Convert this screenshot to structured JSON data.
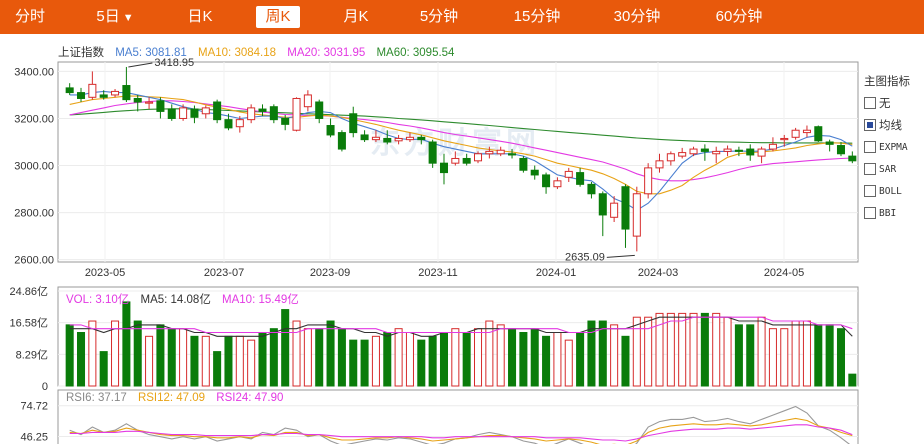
{
  "tabs": [
    {
      "label": "分时",
      "active": false
    },
    {
      "label": "5日",
      "active": false,
      "dropdown": true
    },
    {
      "label": "日K",
      "active": false
    },
    {
      "label": "周K",
      "active": true
    },
    {
      "label": "月K",
      "active": false
    },
    {
      "label": "5分钟",
      "active": false
    },
    {
      "label": "15分钟",
      "active": false
    },
    {
      "label": "30分钟",
      "active": false
    },
    {
      "label": "60分钟",
      "active": false
    }
  ],
  "dropdown_icon": "caret-down-icon",
  "indicator_panel": {
    "title": "主图指标",
    "items": [
      {
        "label": "无",
        "checked": false
      },
      {
        "label": "均线",
        "checked": true
      },
      {
        "label": "EXPMA",
        "checked": false
      },
      {
        "label": "SAR",
        "checked": false
      },
      {
        "label": "BOLL",
        "checked": false
      },
      {
        "label": "BBI",
        "checked": false
      }
    ]
  },
  "price_legend": {
    "name": "上证指数",
    "ma5": "MA5: 3081.81",
    "ma10": "MA10: 3084.18",
    "ma20": "MA20: 3031.95",
    "ma60": "MA60: 3095.54"
  },
  "volume_legend": {
    "vol": "VOL: 3.10亿",
    "ma5": "MA5: 14.08亿",
    "ma10": "MA10: 15.49亿"
  },
  "rsi_legend": {
    "rsi6": "RSI6: 37.17",
    "rsi12": "RSI12: 47.09",
    "rsi24": "RSI24: 47.90"
  },
  "watermark": "东方财富网",
  "colors": {
    "up": "#d62b2b",
    "down": "#0a7c0a",
    "ma5": "#4a7fd0",
    "ma10": "#e8a317",
    "ma20": "#e339e3",
    "ma60": "#2e8b2e",
    "accent": "#e8590c"
  },
  "chart_data": [
    {
      "type": "candlestick",
      "title": "上证指数",
      "y_ticks": [
        "3400.00",
        "3200.00",
        "3000.00",
        "2800.00",
        "2600.00"
      ],
      "ylim": [
        2590,
        3440
      ],
      "x_ticks": [
        "2023-05",
        "2023-07",
        "2023-09",
        "2023-11",
        "2024-01",
        "2024-03",
        "2024-05"
      ],
      "annotations": {
        "high": "3418.95",
        "low": "2635.09"
      },
      "candles": [
        [
          3330,
          3310,
          3350,
          3300
        ],
        [
          3310,
          3285,
          3330,
          3270
        ],
        [
          3290,
          3345,
          3400,
          3280
        ],
        [
          3300,
          3290,
          3320,
          3280
        ],
        [
          3300,
          3315,
          3325,
          3290
        ],
        [
          3340,
          3280,
          3418.95,
          3270
        ],
        [
          3285,
          3270,
          3300,
          3230
        ],
        [
          3265,
          3270,
          3290,
          3240
        ],
        [
          3275,
          3230,
          3290,
          3200
        ],
        [
          3240,
          3200,
          3260,
          3190
        ],
        [
          3200,
          3245,
          3260,
          3190
        ],
        [
          3240,
          3205,
          3255,
          3180
        ],
        [
          3220,
          3245,
          3255,
          3200
        ],
        [
          3270,
          3195,
          3280,
          3180
        ],
        [
          3195,
          3160,
          3220,
          3150
        ],
        [
          3165,
          3195,
          3210,
          3140
        ],
        [
          3195,
          3245,
          3260,
          3180
        ],
        [
          3240,
          3230,
          3260,
          3210
        ],
        [
          3250,
          3195,
          3260,
          3180
        ],
        [
          3200,
          3175,
          3215,
          3150
        ],
        [
          3150,
          3285,
          3290,
          3145
        ],
        [
          3250,
          3300,
          3320,
          3230
        ],
        [
          3270,
          3200,
          3280,
          3180
        ],
        [
          3170,
          3130,
          3200,
          3120
        ],
        [
          3140,
          3070,
          3150,
          3060
        ],
        [
          3220,
          3140,
          3250,
          3120
        ],
        [
          3130,
          3110,
          3150,
          3100
        ],
        [
          3110,
          3120,
          3150,
          3100
        ],
        [
          3115,
          3100,
          3150,
          3090
        ],
        [
          3105,
          3115,
          3130,
          3090
        ],
        [
          3110,
          3120,
          3140,
          3100
        ],
        [
          3120,
          3110,
          3130,
          3090
        ],
        [
          3100,
          3010,
          3110,
          2990
        ],
        [
          3010,
          2970,
          3050,
          2920
        ],
        [
          3010,
          3030,
          3060,
          3000
        ],
        [
          3030,
          3010,
          3050,
          3000
        ],
        [
          3020,
          3050,
          3060,
          3010
        ],
        [
          3050,
          3060,
          3080,
          3030
        ],
        [
          3050,
          3065,
          3080,
          3040
        ],
        [
          3050,
          3045,
          3070,
          3030
        ],
        [
          3030,
          2980,
          3040,
          2970
        ],
        [
          2980,
          2960,
          3000,
          2940
        ],
        [
          2960,
          2910,
          2970,
          2880
        ],
        [
          2910,
          2935,
          2950,
          2900
        ],
        [
          2950,
          2975,
          2990,
          2930
        ],
        [
          2970,
          2920,
          2990,
          2910
        ],
        [
          2920,
          2880,
          2930,
          2860
        ],
        [
          2880,
          2790,
          2890,
          2700
        ],
        [
          2780,
          2840,
          2870,
          2760
        ],
        [
          2910,
          2730,
          2920,
          2650
        ],
        [
          2700,
          2880,
          2910,
          2635.09
        ],
        [
          2880,
          2990,
          3010,
          2860
        ],
        [
          2990,
          3020,
          3050,
          2970
        ],
        [
          3020,
          3050,
          3060,
          3000
        ],
        [
          3040,
          3055,
          3075,
          3030
        ],
        [
          3050,
          3070,
          3080,
          3040
        ],
        [
          3070,
          3060,
          3090,
          3020
        ],
        [
          3050,
          3060,
          3080,
          3010
        ],
        [
          3060,
          3070,
          3085,
          3040
        ],
        [
          3065,
          3060,
          3080,
          3040
        ],
        [
          3070,
          3045,
          3090,
          3020
        ],
        [
          3040,
          3070,
          3080,
          3010
        ],
        [
          3070,
          3090,
          3120,
          3060
        ],
        [
          3110,
          3115,
          3130,
          3080
        ],
        [
          3120,
          3150,
          3160,
          3110
        ],
        [
          3140,
          3150,
          3170,
          3120
        ],
        [
          3165,
          3105,
          3170,
          3100
        ],
        [
          3100,
          3090,
          3110,
          3060
        ],
        [
          3085,
          3050,
          3100,
          3040
        ],
        [
          3040,
          3020,
          3060,
          3010
        ]
      ],
      "ma5": [
        3300,
        3300,
        3310,
        3315,
        3310,
        3310,
        3300,
        3290,
        3280,
        3265,
        3250,
        3240,
        3225,
        3220,
        3210,
        3200,
        3205,
        3210,
        3210,
        3200,
        3210,
        3225,
        3230,
        3225,
        3200,
        3180,
        3165,
        3150,
        3130,
        3115,
        3110,
        3112,
        3095,
        3080,
        3070,
        3060,
        3050,
        3050,
        3050,
        3050,
        3040,
        3020,
        2990,
        2960,
        2950,
        2940,
        2935,
        2900,
        2860,
        2840,
        2810,
        2840,
        2890,
        2950,
        3010,
        3045,
        3055,
        3060,
        3060,
        3062,
        3060,
        3062,
        3070,
        3085,
        3100,
        3120,
        3128,
        3125,
        3110,
        3082
      ],
      "ma10": [
        3260,
        3270,
        3280,
        3285,
        3290,
        3295,
        3295,
        3292,
        3290,
        3285,
        3280,
        3270,
        3258,
        3248,
        3238,
        3228,
        3220,
        3215,
        3210,
        3205,
        3205,
        3210,
        3215,
        3210,
        3205,
        3195,
        3185,
        3175,
        3162,
        3150,
        3140,
        3130,
        3118,
        3105,
        3095,
        3085,
        3075,
        3068,
        3062,
        3058,
        3050,
        3040,
        3025,
        3010,
        3000,
        2990,
        2980,
        2965,
        2945,
        2920,
        2890,
        2880,
        2880,
        2895,
        2915,
        2950,
        2980,
        3005,
        3035,
        3050,
        3055,
        3058,
        3062,
        3068,
        3075,
        3085,
        3092,
        3097,
        3095,
        3090
      ],
      "ma20": [
        3215,
        3225,
        3235,
        3245,
        3255,
        3262,
        3268,
        3272,
        3275,
        3275,
        3272,
        3268,
        3262,
        3256,
        3250,
        3242,
        3235,
        3228,
        3222,
        3217,
        3215,
        3213,
        3212,
        3210,
        3205,
        3200,
        3195,
        3190,
        3183,
        3175,
        3168,
        3160,
        3150,
        3140,
        3132,
        3125,
        3118,
        3110,
        3103,
        3095,
        3085,
        3075,
        3065,
        3055,
        3045,
        3035,
        3025,
        3015,
        3000,
        2985,
        2965,
        2950,
        2940,
        2935,
        2935,
        2940,
        2948,
        2958,
        2970,
        2983,
        2994,
        3002,
        3008,
        3012,
        3016,
        3020,
        3024,
        3027,
        3030,
        3032
      ],
      "ma60": [
        3215,
        3218,
        3222,
        3226,
        3230,
        3233,
        3236,
        3239,
        3240,
        3241,
        3241,
        3240,
        3238,
        3236,
        3234,
        3232,
        3230,
        3228,
        3226,
        3224,
        3222,
        3220,
        3218,
        3216,
        3214,
        3212,
        3210,
        3207,
        3204,
        3200,
        3197,
        3194,
        3190,
        3186,
        3182,
        3178,
        3174,
        3170,
        3166,
        3161,
        3157,
        3153,
        3149,
        3145,
        3141,
        3137,
        3133,
        3129,
        3125,
        3121,
        3117,
        3114,
        3111,
        3108,
        3106,
        3104,
        3102,
        3101,
        3100,
        3099,
        3098,
        3097,
        3097,
        3096,
        3096,
        3096,
        3096,
        3096,
        3096,
        3095
      ]
    },
    {
      "type": "bar",
      "title": "VOL",
      "unit": "亿",
      "y_ticks": [
        "24.86亿",
        "16.58亿",
        "8.29亿",
        "0"
      ],
      "ylim": [
        0,
        24.86
      ],
      "values": [
        16,
        14,
        17,
        9,
        17,
        22,
        17,
        13,
        16,
        15,
        15,
        13,
        13,
        9,
        13,
        13,
        12,
        14,
        15,
        20,
        17,
        15,
        15,
        17,
        15,
        12,
        12,
        13,
        14,
        15,
        14,
        12,
        13,
        14,
        15,
        14,
        15,
        17,
        16,
        15,
        14,
        15,
        13,
        14,
        12,
        14,
        17,
        17,
        16,
        13,
        18,
        18,
        19,
        19,
        19,
        19,
        19,
        19,
        18,
        16,
        16,
        18,
        15,
        15,
        17,
        17,
        16,
        16,
        15,
        3.1
      ],
      "ma5": [
        15,
        15,
        15,
        14,
        15,
        15,
        16,
        16,
        16,
        15,
        15,
        14,
        14,
        13,
        13,
        13,
        13,
        13,
        14,
        15,
        15,
        16,
        16,
        16,
        15,
        15,
        14,
        14,
        13,
        14,
        14,
        13,
        13,
        14,
        14,
        14,
        15,
        15,
        15,
        15,
        15,
        15,
        14,
        14,
        14,
        14,
        15,
        15,
        15,
        15,
        16,
        17,
        18,
        18,
        18,
        18,
        18,
        18,
        18,
        17,
        17,
        17,
        16,
        16,
        16,
        16,
        16,
        16,
        16,
        13
      ],
      "ma10": [
        16,
        16,
        15,
        15,
        15,
        15,
        15,
        15,
        15,
        15,
        15,
        15,
        14,
        14,
        14,
        14,
        14,
        14,
        14,
        14,
        14,
        15,
        15,
        15,
        15,
        15,
        15,
        15,
        14,
        14,
        14,
        14,
        14,
        14,
        14,
        14,
        14,
        14,
        15,
        15,
        15,
        15,
        15,
        15,
        14,
        14,
        14,
        15,
        15,
        15,
        15,
        15,
        16,
        17,
        17,
        18,
        18,
        18,
        18,
        18,
        18,
        18,
        17,
        17,
        17,
        17,
        16,
        16,
        16,
        15
      ]
    },
    {
      "type": "line",
      "title": "RSI",
      "y_ticks": [
        "74.72",
        "46.25"
      ],
      "ylim": [
        30,
        80
      ],
      "series": [
        {
          "name": "RSI6",
          "values": [
            52,
            48,
            55,
            50,
            52,
            58,
            52,
            48,
            46,
            44,
            46,
            44,
            46,
            42,
            44,
            46,
            44,
            50,
            48,
            54,
            52,
            46,
            48,
            42,
            38,
            40,
            42,
            44,
            43,
            45,
            44,
            41,
            38,
            40,
            44,
            45,
            48,
            50,
            48,
            46,
            42,
            40,
            36,
            40,
            44,
            40,
            36,
            30,
            34,
            31,
            40,
            55,
            60,
            62,
            62,
            64,
            60,
            61,
            63,
            60,
            58,
            62,
            66,
            70,
            74,
            68,
            56,
            52,
            45,
            37
          ]
        },
        {
          "name": "RSI12",
          "values": [
            50,
            49,
            52,
            50,
            51,
            54,
            52,
            50,
            48,
            47,
            47,
            46,
            46,
            45,
            45,
            46,
            45,
            48,
            47,
            50,
            50,
            47,
            48,
            45,
            43,
            43,
            44,
            45,
            45,
            46,
            45,
            44,
            42,
            43,
            44,
            45,
            46,
            47,
            47,
            46,
            45,
            44,
            42,
            43,
            44,
            43,
            41,
            38,
            39,
            38,
            42,
            50,
            54,
            56,
            57,
            58,
            57,
            57,
            58,
            57,
            56,
            57,
            59,
            61,
            63,
            61,
            56,
            54,
            50,
            47
          ]
        },
        {
          "name": "RSI24",
          "values": [
            49,
            49,
            50,
            50,
            50,
            51,
            51,
            50,
            49,
            48,
            48,
            48,
            47,
            47,
            47,
            47,
            47,
            48,
            48,
            49,
            49,
            48,
            48,
            47,
            46,
            46,
            46,
            46,
            46,
            46,
            46,
            46,
            45,
            45,
            46,
            46,
            46,
            46,
            46,
            46,
            46,
            46,
            45,
            45,
            45,
            45,
            44,
            43,
            43,
            42,
            44,
            47,
            49,
            51,
            52,
            53,
            53,
            53,
            54,
            54,
            53,
            54,
            55,
            56,
            57,
            57,
            55,
            54,
            52,
            48
          ]
        }
      ]
    }
  ]
}
